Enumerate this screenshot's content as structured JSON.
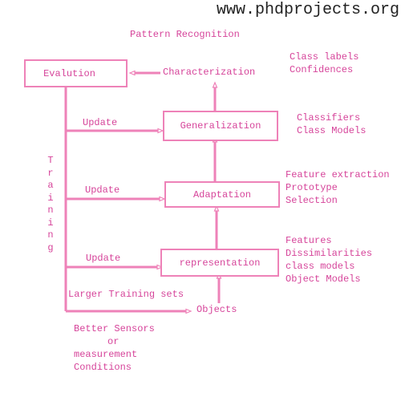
{
  "watermark": "www.phdprojects.org",
  "title": "Pattern Recognition",
  "boxes": {
    "evaluation": "Evalution",
    "generalization": "Generalization",
    "adaptation": "Adaptation",
    "representation": "representation"
  },
  "labels": {
    "characterization": "Characterization",
    "objects": "Objects",
    "update1": "Update",
    "update2": "Update",
    "update3": "Update",
    "larger_training": "Larger Training sets",
    "training_vertical": [
      "T",
      "r",
      "a",
      "i",
      "n",
      "i",
      "n",
      "g"
    ]
  },
  "notes": {
    "characterization": [
      "Class labels",
      "Confidences"
    ],
    "generalization": [
      "Classifiers",
      "Class Models"
    ],
    "adaptation": [
      "Feature extraction",
      "Prototype",
      "Selection"
    ],
    "representation": [
      "Features",
      "Dissimilarities",
      "class models",
      "Object Models"
    ],
    "bottom": [
      "Better Sensors",
      "or",
      "measurement",
      "Conditions"
    ]
  },
  "colors": {
    "text": "#d6449a",
    "line": "#ee82b8"
  }
}
